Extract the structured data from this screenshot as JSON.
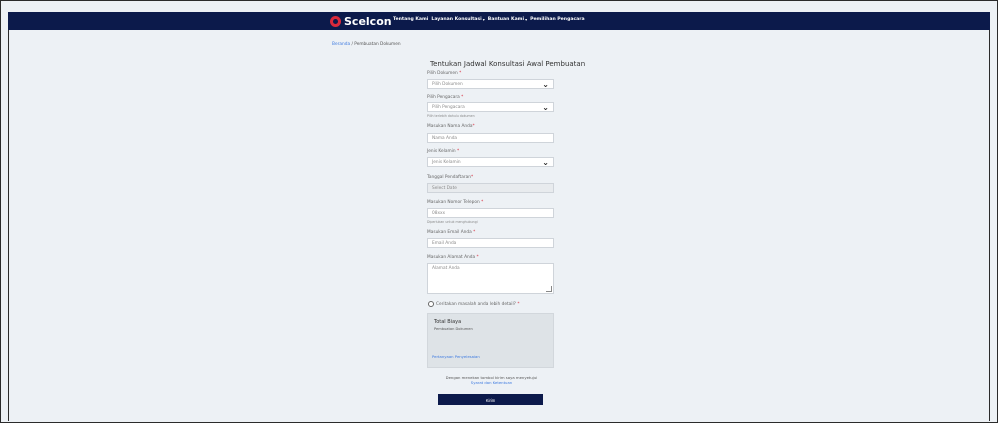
{
  "nav": {
    "brand": "Scelcon",
    "links": [
      {
        "label": "Tentang Kami",
        "caret": ""
      },
      {
        "label": "Layanan Konsultasi",
        "caret": "▾"
      },
      {
        "label": "Bantuan Kami",
        "caret": "▾"
      },
      {
        "label": "Pemilihan Pengacara",
        "caret": ""
      }
    ]
  },
  "breadcrumb": {
    "home": "Beranda",
    "sep": "/",
    "current": "Pembuatan Dokumen"
  },
  "form": {
    "title": "Tentukan Jadwal Konsultasi Awal Pembuatan",
    "document": {
      "label": "Pilih Dokumen ",
      "req": "*",
      "placeholder": "Pilih Dokumen"
    },
    "lawyer": {
      "label": "Pilih Pengacara ",
      "req": "*",
      "placeholder": "Pilih Pengacara",
      "help": "Pilih terlebih dahulu dokumen"
    },
    "name": {
      "label": "Masukan Nama Anda",
      "req": "*",
      "placeholder": "Nama Anda"
    },
    "gender": {
      "label": "Jenis Kelamin ",
      "req": "*",
      "placeholder": "Jenis Kelamin"
    },
    "date": {
      "label": "Tanggal Pendaftaran",
      "req": "*",
      "placeholder": "Select Date"
    },
    "phone": {
      "label": "Masukan Nomor Telepon ",
      "req": "*",
      "placeholder": "08xxx",
      "help": "Diperlukan untuk menghubungi"
    },
    "email": {
      "label": "Masukan Email Anda ",
      "req": "*",
      "placeholder": "Email Anda"
    },
    "address": {
      "label": "Masukan Alamat Anda ",
      "req": "*",
      "placeholder": "Alamat Anda"
    },
    "detail_check": {
      "label": "Ceritakan masalah anda lebih detail? ",
      "req": "*"
    },
    "cost": {
      "title": "Total Biaya",
      "item": "Pembuatan Dokumen",
      "link": "Pertanyaan Penyelesaian"
    },
    "terms": {
      "text": "Dengan menekan tombol kirim saya menyetujui",
      "link": "Syarat dan Ketentuan"
    },
    "submit": "Kirim"
  },
  "colors": {
    "navbar": "#0c1a4b",
    "accent": "#d9293b",
    "link": "#3d7ae0"
  }
}
